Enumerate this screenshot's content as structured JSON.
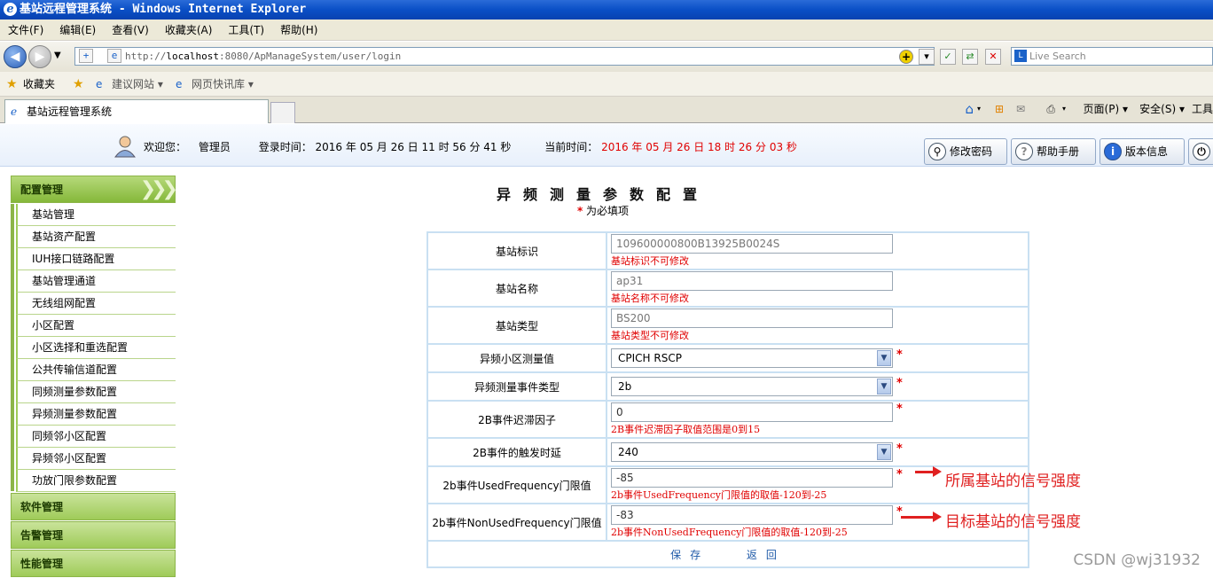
{
  "window": {
    "title": "基站远程管理系统 - Windows Internet Explorer"
  },
  "menu": [
    "文件(F)",
    "编辑(E)",
    "查看(V)",
    "收藏夹(A)",
    "工具(T)",
    "帮助(H)"
  ],
  "address": {
    "prefix": "http://",
    "host": "localhost",
    "rest": ":8080/ApManageSystem/user/login",
    "search_placeholder": "Live Search"
  },
  "favorites": {
    "label": "收藏夹",
    "item1": "建议网站 ▾",
    "item2": "网页快讯库 ▾"
  },
  "tab": {
    "title": "基站远程管理系统"
  },
  "commands": {
    "page": "页面(P) ▾",
    "safety": "安全(S) ▾",
    "tools": "工具"
  },
  "header": {
    "welcome": "欢迎您：",
    "user": "管理员",
    "login_label": "登录时间：",
    "login_time": "2016 年  05 月  26 日  11 时  56 分  41 秒",
    "now_label": "当前时间：",
    "now_time": "2016 年  05 月  26 日  18 时  26 分  03 秒",
    "btn_password": "修改密码",
    "btn_help": "帮助手册",
    "btn_version": "版本信息"
  },
  "sidebar": {
    "config": "配置管理",
    "items": [
      "基站管理",
      "基站资产配置",
      "IUH接口链路配置",
      "基站管理通道",
      "无线组网配置",
      "小区配置",
      "小区选择和重选配置",
      "公共传输信道配置",
      "同频测量参数配置",
      "异频测量参数配置",
      "同频邻小区配置",
      "异频邻小区配置",
      "功放门限参数配置"
    ],
    "software": "软件管理",
    "alarm": "告警管理",
    "performance": "性能管理"
  },
  "form": {
    "title": "异频测量参数配置",
    "required_note": "为必填项",
    "required_star": "*",
    "rows": [
      {
        "label": "基站标识",
        "value": "109600000800B13925B0024S",
        "error": "基站标识不可修改"
      },
      {
        "label": "基站名称",
        "value": "ap31",
        "error": "基站名称不可修改"
      },
      {
        "label": "基站类型",
        "value": "BS200",
        "error": "基站类型不可修改"
      },
      {
        "label": "异频小区测量值",
        "value": "CPICH RSCP"
      },
      {
        "label": "异频测量事件类型",
        "value": "2b"
      },
      {
        "label": "2B事件迟滞因子",
        "value": "0",
        "error": "2B事件迟滞因子取值范围是0到15"
      },
      {
        "label": "2B事件的触发时延",
        "value": "240"
      },
      {
        "label": "2b事件UsedFrequency门限值",
        "value": "-85",
        "error": "2b事件UsedFrequency门限值的取值-120到-25"
      },
      {
        "label": "2b事件NonUsedFrequency门限值",
        "value": "-83",
        "error": "2b事件NonUsedFrequency门限值的取值-120到-25"
      }
    ],
    "save": "保存",
    "back": "返回"
  },
  "annotations": {
    "used": "所属基站的信号强度",
    "nonused": "目标基站的信号强度"
  },
  "watermark": "CSDN @wj31932",
  "colors": {
    "accent_green": "#9fcb59",
    "error_red": "#e00000",
    "link_blue": "#1f5aa8"
  }
}
